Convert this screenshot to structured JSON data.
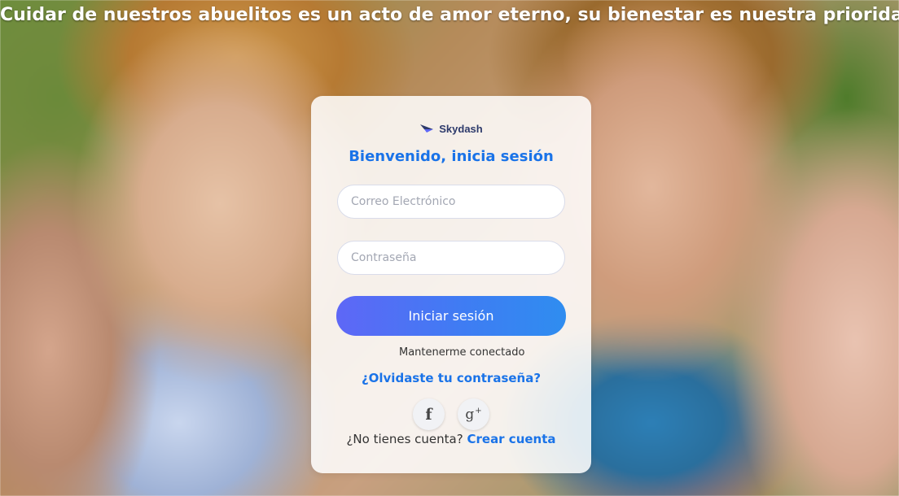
{
  "banner": {
    "headline": "Cuidar de nuestros abuelitos es un acto de amor eterno, su bienestar es nuestra prioridad."
  },
  "brand": {
    "logo_icon": "paper-plane-icon",
    "name": "Skydash"
  },
  "login": {
    "title": "Bienvenido, inicia sesión",
    "email_placeholder": "Correo Electrónico",
    "email_value": "",
    "password_placeholder": "Contraseña",
    "password_value": "",
    "submit_label": "Iniciar sesión",
    "remember_label": "Mantenerme conectado",
    "forgot_label": "¿Olvidaste tu contraseña?"
  },
  "social": {
    "facebook_glyph": "f",
    "google_glyph": "g",
    "google_sup": "+"
  },
  "signup": {
    "prompt": "¿No tienes cuenta?",
    "link_label": "Crear cuenta"
  },
  "colors": {
    "accent": "#1a73e8",
    "button_start": "#5e67f6",
    "button_end": "#2f8df0"
  }
}
